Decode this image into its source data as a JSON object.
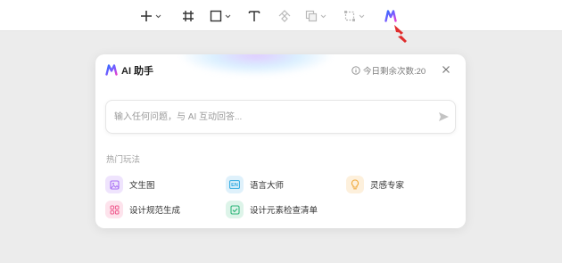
{
  "toolbar": {
    "tools": [
      {
        "name": "add",
        "icon": "plus-icon",
        "has_dropdown": true
      },
      {
        "name": "frame",
        "icon": "frame-crop-icon",
        "has_dropdown": false
      },
      {
        "name": "shape",
        "icon": "rectangle-icon",
        "has_dropdown": true
      },
      {
        "name": "text",
        "icon": "text-icon",
        "has_dropdown": false
      },
      {
        "name": "component",
        "icon": "component-icon",
        "has_dropdown": false
      },
      {
        "name": "boolean",
        "icon": "boolean-icon",
        "has_dropdown": true
      },
      {
        "name": "transform",
        "icon": "transform-icon",
        "has_dropdown": true
      },
      {
        "name": "ai",
        "icon": "ai-logo-icon",
        "has_dropdown": false
      }
    ]
  },
  "panel": {
    "title": "AI 助手",
    "quota_text": "今日剩余次数:20",
    "input_placeholder": "输入任何问题，与 AI 互动回答...",
    "section_title": "热门玩法",
    "features": [
      {
        "label": "文生图",
        "icon": "image-icon",
        "color": "#a970f5",
        "bg": "#efe4fd"
      },
      {
        "label": "语言大师",
        "icon": "en-language-icon",
        "color": "#2aa8e0",
        "bg": "#dff1fb"
      },
      {
        "label": "灵感专家",
        "icon": "lightbulb-icon",
        "color": "#f0a93a",
        "bg": "#fdf0dc"
      },
      {
        "label": "设计规范生成",
        "icon": "grid-icon",
        "color": "#ef5b8e",
        "bg": "#fde3ec"
      },
      {
        "label": "设计元素检查清单",
        "icon": "checklist-icon",
        "color": "#2fb67a",
        "bg": "#ddf4e9"
      }
    ]
  },
  "colors": {
    "accent_red": "#e02d2d",
    "ai_gradient_start": "#2f6bff",
    "ai_gradient_end": "#e53fd0"
  }
}
